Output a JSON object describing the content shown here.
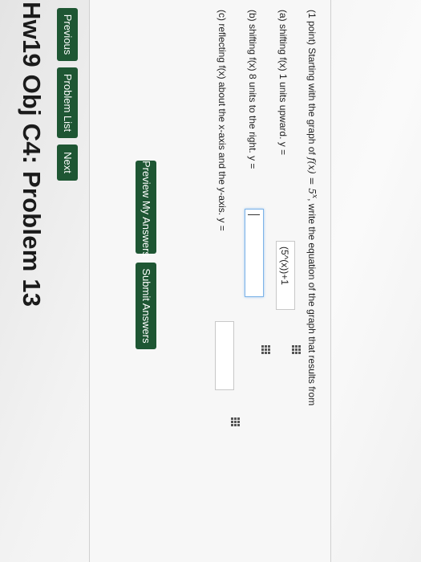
{
  "title": "Hw19 Obj C4: Problem 13",
  "nav": {
    "previous": "Previous",
    "problem_list": "Problem List",
    "next": "Next"
  },
  "problem": {
    "intro_prefix": "(1 point) Starting with the graph of ",
    "intro_func": "f(x) = 5",
    "intro_exp": "x",
    "intro_suffix": ", write the equation of the graph that results from",
    "a_text": "(a) shifting f(x) 1 units upward. y =",
    "a_value": "(5^(x))+1",
    "b_text": "(b) shifting f(x) 8 units to the right. y =",
    "b_value": "",
    "c_text": "(c) reflecting f(x) about the x-axis and the y-axis. y =",
    "c_value": ""
  },
  "actions": {
    "preview": "Preview My Answers",
    "submit": "Submit Answers"
  },
  "colors": {
    "button_green": "#1e5633",
    "focus_blue": "#7db3e8"
  }
}
